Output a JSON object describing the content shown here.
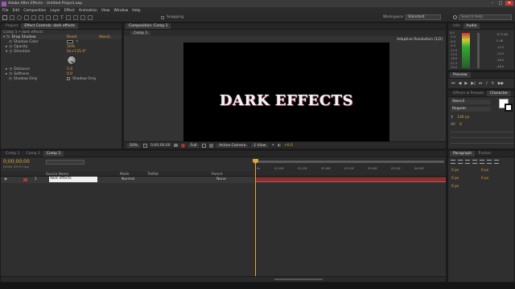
{
  "titlebar": {
    "title": "Adobe After Effects - Untitled Project.aep",
    "controls": [
      "–",
      "□",
      "✕"
    ]
  },
  "menubar": {
    "items": [
      "File",
      "Edit",
      "Composition",
      "Layer",
      "Effect",
      "Animation",
      "View",
      "Window",
      "Help"
    ]
  },
  "toolbar": {
    "snapping_label": "Snapping",
    "workspace_label": "Workspace:",
    "workspace_value": "Standard",
    "search_placeholder": "Search Help"
  },
  "left_panel": {
    "tabs": [
      "Project",
      "Effect Controls: dark effects"
    ],
    "breadcrumb": "Comp 1 • dark effects",
    "effect_name": "Drop Shadow",
    "reset_label": "Reset",
    "about_label": "About...",
    "properties": [
      {
        "label": "Shadow Color",
        "value": ""
      },
      {
        "label": "Opacity",
        "value": "50%"
      },
      {
        "label": "Direction",
        "value": "0x+135.0°"
      },
      {
        "label": "Distance",
        "value": "5.0"
      },
      {
        "label": "Softness",
        "value": "0.0"
      },
      {
        "label": "Shadow Only",
        "value": "Shadow Only"
      }
    ]
  },
  "composition": {
    "tab_label": "Composition: Comp 1",
    "sub_tab": "Comp 1",
    "resolution_label": "Adaptive Resolution (1/2)",
    "canvas_text": "DARK EFFECTS",
    "zoom": "50%",
    "timecode": "0;00;00;00",
    "quality": "Full",
    "camera": "Active Camera",
    "view": "1 View",
    "offset": "+0.0"
  },
  "timeline": {
    "tabs": [
      "Comp 1",
      "Comp 1",
      "Comp 1"
    ],
    "timecode": "0;00;00;00",
    "fps_label": "00000 (29.97 fps)",
    "columns": {
      "source": "Source Name",
      "mode": "Mode",
      "trkmat": "TrkMat",
      "parent": "Parent"
    },
    "layer": {
      "num": "1",
      "name": "dark effects",
      "mode": "Normal",
      "parent": "None"
    },
    "ruler": [
      "0s",
      "01:00f",
      "01:15f",
      "02:00f",
      "02:15f",
      "03:00f",
      "03:15f",
      "04:00f"
    ]
  },
  "right_panels": {
    "info_tabs": [
      "Info",
      "Audio"
    ],
    "audio_levels_left": [
      "0.0",
      "-3.0",
      "-6.0",
      "-9.0",
      "-12.0",
      "-15.0",
      "-18.0",
      "-21.0",
      "-24.0"
    ],
    "audio_levels_right": [
      "12.0 dB",
      "0 dB",
      "-12.0",
      "-24.0",
      "-36.0",
      "-48.0"
    ],
    "preview_tab": "Preview",
    "effects_tab": "Effects & Presets",
    "character_tab": "Character",
    "font_name": "Stencil",
    "font_style": "Regular",
    "font_size": "136 px",
    "tracking": "0",
    "paragraph_tab": "Paragraph",
    "tracker_tab": "Tracker",
    "para_values": [
      "0 px",
      "0 px",
      "0 px",
      "0 px",
      "0 px"
    ]
  },
  "colors": {
    "accent": "#e3a53a",
    "timeline_bar": "#8a2e2e",
    "playhead": "#e3a53a",
    "canvas": "#000000"
  }
}
